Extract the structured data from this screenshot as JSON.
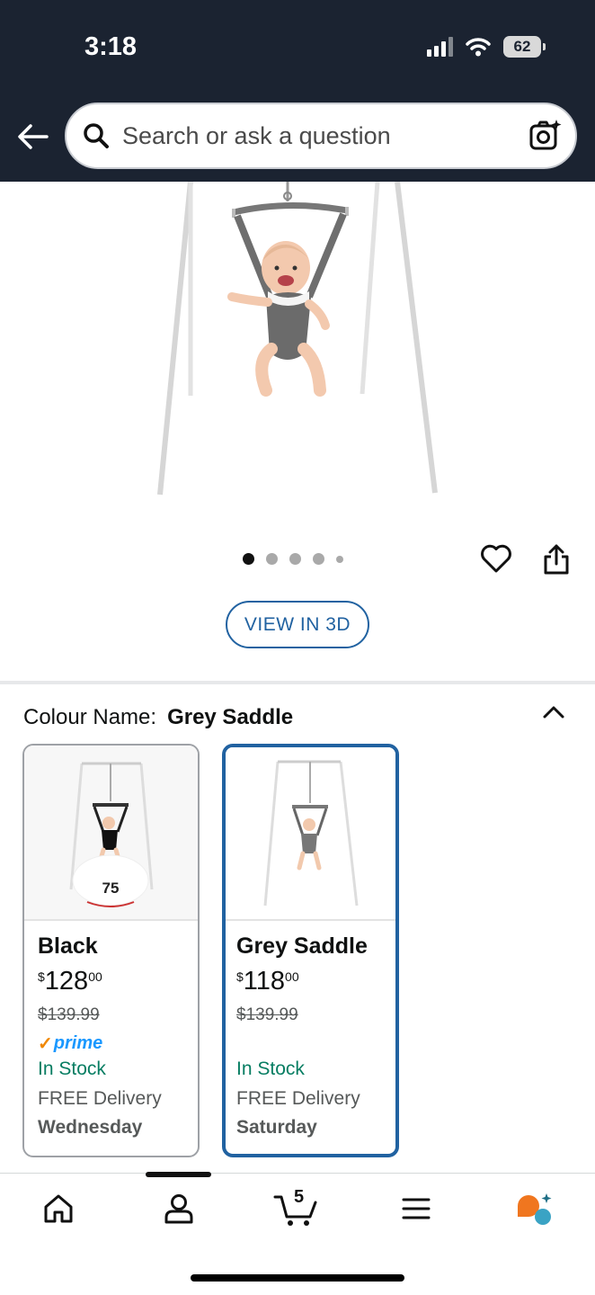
{
  "status_bar": {
    "time": "3:18",
    "battery": "62"
  },
  "header": {
    "search_placeholder": "Search or ask a question"
  },
  "gallery": {
    "image_count": 5,
    "active_index": 0,
    "view_3d_label": "VIEW IN 3D"
  },
  "variants": {
    "label": "Colour Name:",
    "selected_value": "Grey Saddle",
    "options": [
      {
        "name": "Black",
        "price_currency": "$",
        "price_whole": "128",
        "price_cents": "00",
        "list_price": "$139.99",
        "prime": "prime",
        "stock": "In Stock",
        "delivery": "FREE Delivery",
        "delivery_day": "Wednesday",
        "badge_text": "75"
      },
      {
        "name": "Grey Saddle",
        "price_currency": "$",
        "price_whole": "118",
        "price_cents": "00",
        "list_price": "$139.99",
        "stock": "In Stock",
        "delivery": "FREE Delivery",
        "delivery_day": "Saturday"
      }
    ]
  },
  "bottom_nav": {
    "cart_count": "5"
  },
  "colors": {
    "header_bg": "#1b2331",
    "link_blue": "#2162a1",
    "in_stock": "#067d62",
    "prime_blue": "#1a98ff",
    "ai_orange": "#f0761f",
    "ai_teal": "#3aa3c4"
  }
}
